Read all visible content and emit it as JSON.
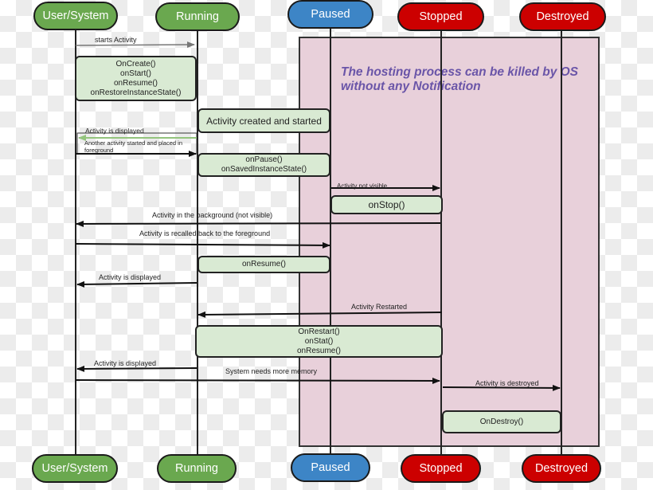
{
  "states": {
    "user_system": "User/System",
    "running": "Running",
    "paused": "Paused",
    "stopped": "Stopped",
    "destroyed": "Destroyed"
  },
  "colors": {
    "user_system": "#6aa84f",
    "running": "#6aa84f",
    "paused": "#3d85c6",
    "stopped": "#cc0000",
    "destroyed": "#cc0000",
    "region": "#e8d0da",
    "callback_box": "#d9ead3",
    "note_text": "#6a55a8"
  },
  "note": "The hosting process can be killed by OS without any Notification",
  "boxes": {
    "create": [
      "OnCreate()",
      "onStart()",
      "onResume()",
      "onRestoreInstanceState()"
    ],
    "created_started": "Activity created and started",
    "pause": [
      "onPause()",
      "onSavedInstanceState()"
    ],
    "stop": "onStop()",
    "resume": "onResume()",
    "restart": [
      "OnRestart()",
      "onStat()",
      "onResume()"
    ],
    "destroy": "OnDestroy()"
  },
  "messages": {
    "starts_activity": "starts Activity",
    "activity_displayed_1": "Activity is displayed",
    "another_activity": "Another activity started and placed in foreground",
    "activity_not_visible": "Activity not visible",
    "activity_background": "Activity in the background (not visible)",
    "activity_recalled": "Activity is recalled back to the foreground",
    "activity_displayed_2": "Activity is displayed",
    "activity_restarted": "Activity Restarted",
    "activity_displayed_3": "Activity is displayed",
    "system_memory": "System needs more memory",
    "activity_destroyed": "Activity is destroyed"
  }
}
